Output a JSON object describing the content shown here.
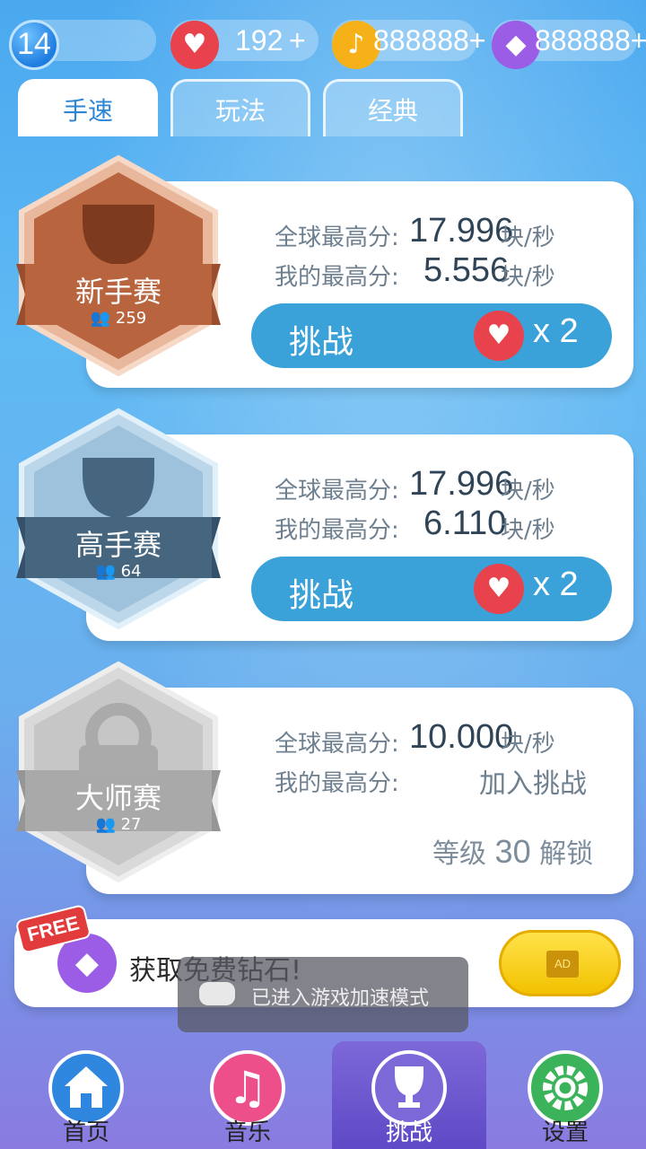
{
  "topbar": {
    "level": "14",
    "hearts": "192",
    "hearts_plus": "+",
    "notes": "888888+",
    "diamonds": "888888+"
  },
  "tabs": [
    {
      "label": "手速",
      "active": true
    },
    {
      "label": "玩法",
      "active": false
    },
    {
      "label": "经典",
      "active": false
    }
  ],
  "leagues": [
    {
      "name": "新手赛",
      "players": "259",
      "global_label": "全球最高分:",
      "global_value": "17.996",
      "unit": "块/秒",
      "my_label": "我的最高分:",
      "my_value": "5.556",
      "button_label": "挑战",
      "cost": "x 2",
      "color": "#b8653f"
    },
    {
      "name": "高手赛",
      "players": "64",
      "global_label": "全球最高分:",
      "global_value": "17.996",
      "unit": "块/秒",
      "my_label": "我的最高分:",
      "my_value": "6.110",
      "button_label": "挑战",
      "cost": "x 2",
      "color": "#46657f"
    },
    {
      "name": "大师赛",
      "players": "27",
      "global_label": "全球最高分:",
      "global_value": "10.000",
      "unit": "块/秒",
      "my_label": "我的最高分:",
      "my_value": "加入挑战",
      "unlock_prefix": "等级",
      "unlock_level": "30",
      "unlock_suffix": "解锁",
      "color": "#a9a9a9"
    }
  ],
  "free": {
    "badge": "FREE",
    "text": "获取免费钻石!",
    "ad_label": "AD"
  },
  "toast": {
    "text": "已进入游戏加速模式"
  },
  "nav": [
    {
      "label": "首页",
      "icon": "home-icon",
      "color": "#2f86df"
    },
    {
      "label": "音乐",
      "icon": "music-icon",
      "color": "#ec4f8a"
    },
    {
      "label": "挑战",
      "icon": "trophy-icon",
      "color": "#7d68d8"
    },
    {
      "label": "设置",
      "icon": "gear-icon",
      "color": "#3bb35a"
    }
  ]
}
